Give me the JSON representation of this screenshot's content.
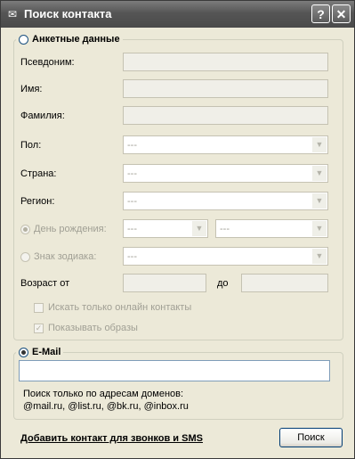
{
  "window": {
    "title": "Поиск контакта",
    "help_label": "?",
    "close_label": "✕",
    "icon": "agent-icon"
  },
  "profile_group": {
    "legend": "Анкетные данные",
    "selected": false,
    "nickname_label": "Псевдоним:",
    "nickname_value": "",
    "name_label": "Имя:",
    "name_value": "",
    "surname_label": "Фамилия:",
    "surname_value": "",
    "gender_label": "Пол:",
    "gender_value": "---",
    "country_label": "Страна:",
    "country_value": "---",
    "region_label": "Регион:",
    "region_value": "---",
    "birthday_label": "День рождения:",
    "birthday_day": "---",
    "birthday_month": "---",
    "zodiac_label": "Знак зодиака:",
    "zodiac_value": "---",
    "age_from_label": "Возраст от",
    "age_to_label": "до",
    "online_only_label": "Искать только онлайн контакты",
    "online_only_checked": false,
    "show_images_label": "Показывать образы",
    "show_images_checked": true
  },
  "email_group": {
    "legend": "E-Mail",
    "selected": true,
    "value": "",
    "hint_line1": "Поиск только по адресам доменов:",
    "hint_line2": "@mail.ru, @list.ru, @bk.ru, @inbox.ru"
  },
  "footer": {
    "add_contact_link": "Добавить контакт для звонков и SMS",
    "search_button": "Поиск"
  }
}
